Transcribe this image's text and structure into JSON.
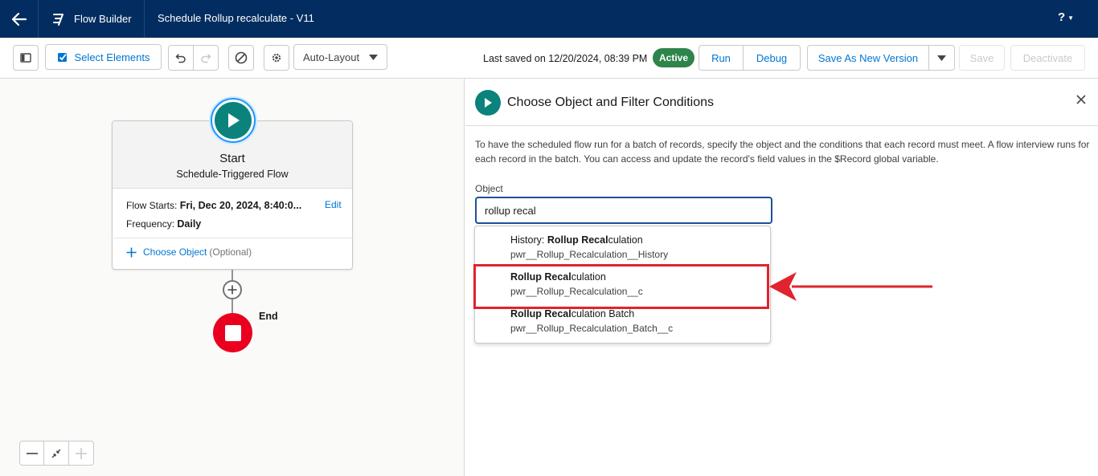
{
  "header": {
    "app_name": "Flow Builder",
    "flow_title": "Schedule Rollup recalculate - V11",
    "help": "?"
  },
  "toolbar": {
    "select_elements": "Select Elements",
    "layout": "Auto-Layout",
    "last_saved": "Last saved on 12/20/2024, 08:39 PM",
    "status_badge": "Active",
    "run": "Run",
    "debug": "Debug",
    "save_as_new_version": "Save As New Version",
    "save": "Save",
    "deactivate": "Deactivate"
  },
  "canvas": {
    "start": {
      "title": "Start",
      "subtitle": "Schedule-Triggered Flow",
      "flow_starts_label": "Flow Starts:",
      "flow_starts_value": "Fri, Dec 20, 2024, 8:40:0...",
      "frequency_label": "Frequency:",
      "frequency_value": "Daily",
      "edit": "Edit",
      "choose_object": "Choose Object",
      "optional": "(Optional)"
    },
    "end_label": "End"
  },
  "panel": {
    "title": "Choose Object and Filter Conditions",
    "description": "To have the scheduled flow run for a batch of records, specify the object and the conditions that each record must meet. A flow interview runs for each record in the batch. You can access and update the record's field values in the $Record global variable.",
    "object_label": "Object",
    "object_value": "rollup recal",
    "options": [
      {
        "prefix": "History: ",
        "match": "Rollup Recal",
        "rest": "culation",
        "api": "pwr__Rollup_Recalculation__History"
      },
      {
        "prefix": "",
        "match": "Rollup Recal",
        "rest": "culation",
        "api": "pwr__Rollup_Recalculation__c"
      },
      {
        "prefix": "",
        "match": "Rollup Recal",
        "rest": "culation Batch",
        "api": "pwr__Rollup_Recalculation_Batch__c"
      }
    ]
  },
  "colors": {
    "header_bg": "#032d60",
    "brand_blue": "#0176d3",
    "active_green": "#2e844a",
    "start_teal": "#0b827c",
    "end_red": "#ea001e",
    "highlight_red": "#e0232e"
  },
  "icons": [
    "back-arrow-icon",
    "flow-builder-icon",
    "sidebar-toggle-icon",
    "select-checkbox-icon",
    "undo-icon",
    "redo-icon",
    "no-entry-icon",
    "gear-icon",
    "chevron-down-icon",
    "play-icon",
    "plus-icon",
    "stop-icon",
    "zoom-out-icon",
    "fit-view-icon",
    "zoom-in-icon",
    "close-icon"
  ]
}
